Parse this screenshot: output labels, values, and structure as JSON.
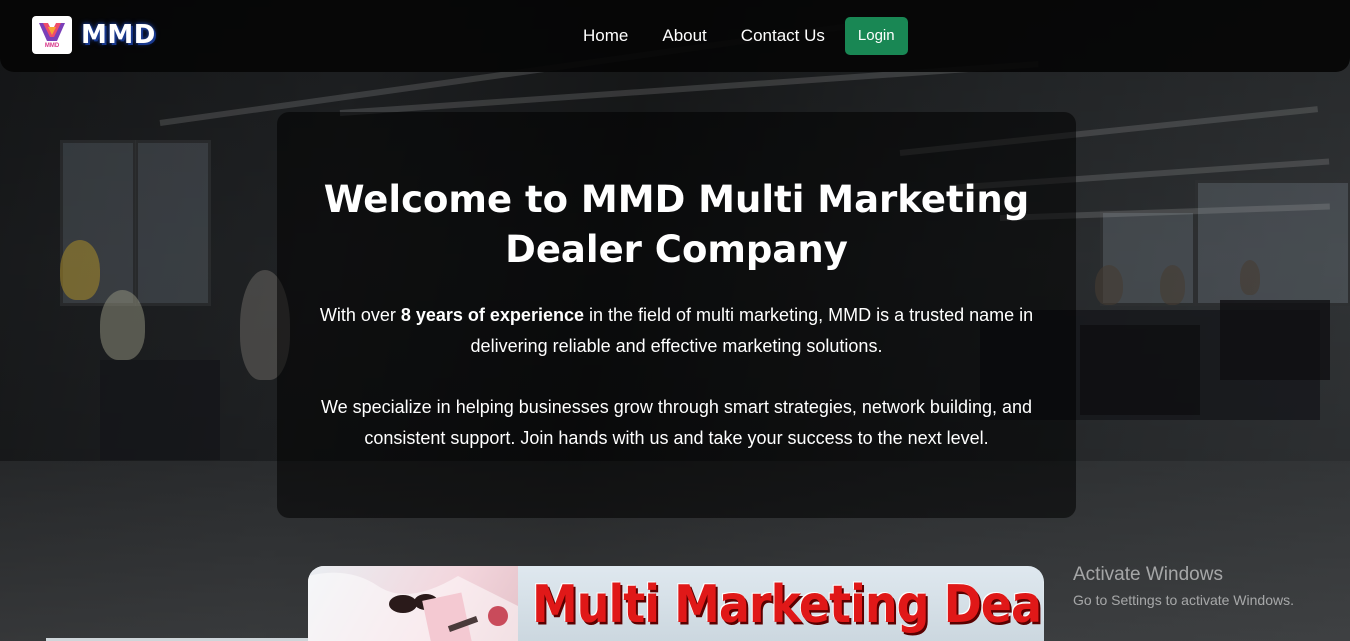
{
  "brand": {
    "logo_text": "MMD",
    "name": "MMD"
  },
  "nav": {
    "links": [
      "Home",
      "About",
      "Contact Us"
    ],
    "login_label": "Login"
  },
  "hero": {
    "title": "Welcome to MMD Multi Marketing Dealer Company",
    "p1_before": "With over ",
    "p1_bold": "8 years of experience",
    "p1_after": " in the field of multi marketing, MMD is a trusted name in delivering reliable and effective marketing solutions.",
    "p2": "We specialize in helping businesses grow through smart strategies, network building, and consistent support. Join hands with us and take your success to the next level."
  },
  "banner": {
    "title": "Multi Marketing Dealers"
  },
  "watermark": {
    "title": "Activate Windows",
    "subtitle": "Go to Settings to activate Windows."
  },
  "colors": {
    "login_bg": "#198754",
    "banner_red": "#e01818",
    "brand_glow": "#1a3a8f"
  }
}
